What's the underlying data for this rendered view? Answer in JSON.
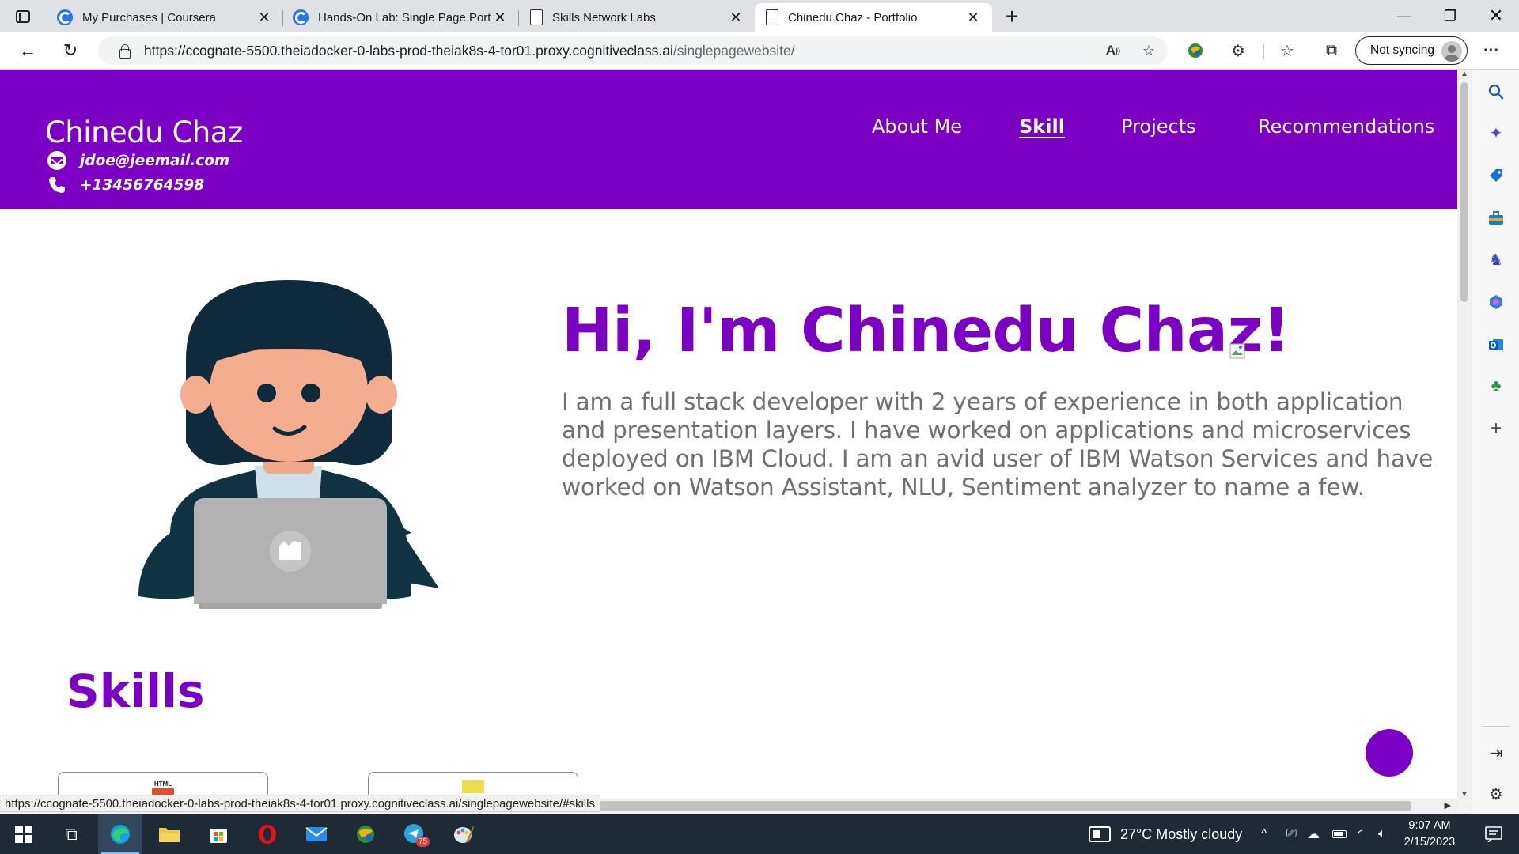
{
  "browser": {
    "tabs": [
      {
        "title": "My Purchases | Coursera",
        "favicon": "coursera-icon",
        "active": false
      },
      {
        "title": "Hands-On Lab: Single Page Portf",
        "favicon": "coursera-icon",
        "active": false
      },
      {
        "title": "Skills Network Labs",
        "favicon": "page-icon",
        "active": false
      },
      {
        "title": "Chinedu Chaz - Portfolio",
        "favicon": "page-icon",
        "active": true
      }
    ],
    "url_host": "https://ccognate-5500.theiadocker-0-labs-prod-theiak8s-4-tor01.proxy.cognitiveclass.ai",
    "url_path": "/singlepagewebsite/",
    "profile_label": "Not syncing",
    "status_url": "https://ccognate-5500.theiadocker-0-labs-prod-theiak8s-4-tor01.proxy.cognitiveclass.ai/singlepagewebsite/#skills"
  },
  "site": {
    "name": "Chinedu Chaz",
    "email": "jdoe@jeemail.com",
    "phone": "+13456764598",
    "nav": [
      {
        "label": "About Me",
        "active": false
      },
      {
        "label": "Skill",
        "active": true
      },
      {
        "label": "Projects",
        "active": false
      },
      {
        "label": "Recommendations",
        "active": false
      }
    ],
    "hero_title": "Hi, I'm Chinedu Chaz!",
    "hero_description": "I am a full stack developer with 2 years of experience in both application and presentation layers. I have worked on applications and microservices deployed on IBM Cloud. I am an avid user of IBM Watson Services and have worked on Watson Assistant, NLU, Sentiment analyzer to name a few.",
    "skills_heading": "Skills",
    "skill_cards": [
      {
        "logo": "html-icon",
        "logo_text": "HTML"
      },
      {
        "logo": "js-icon",
        "logo_text": ""
      }
    ]
  },
  "taskbar": {
    "weather": "27°C  Mostly cloudy",
    "time": "9:07 AM",
    "date": "2/15/2023",
    "telegram_badge": "75"
  },
  "colors": {
    "brand_purple": "#7b00c4",
    "text_gray": "#707070"
  }
}
